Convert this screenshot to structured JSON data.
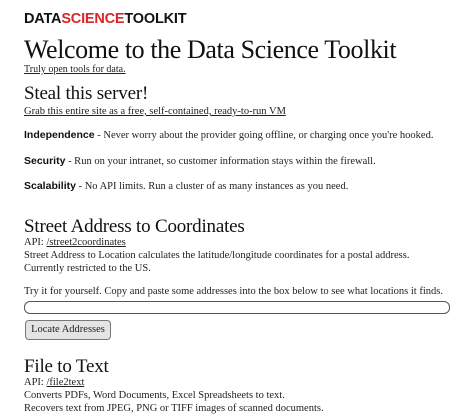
{
  "logo": {
    "part1": "DATA",
    "part2": "SCIENCE",
    "part3": "TOOLKIT"
  },
  "header": {
    "title": "Welcome to the Data Science Toolkit",
    "tagline": "Truly open tools for data."
  },
  "server": {
    "heading": "Steal this server!",
    "link": "Grab this entire site as a free, self-contained, ready-to-run VM",
    "features": [
      {
        "label": "Independence",
        "text": " - Never worry about the provider going offline, or charging once you're hooked."
      },
      {
        "label": "Security",
        "text": " - Run on your intranet, so customer information stays within the firewall."
      },
      {
        "label": "Scalability",
        "text": " - No API limits. Run a cluster of  as many instances as you need."
      }
    ]
  },
  "street": {
    "heading": "Street Address to Coordinates",
    "api_prefix": "API: ",
    "api_link": "/street2coordinates",
    "desc1": "Street Address to Location calculates the latitude/longitude coordinates for a postal address.",
    "desc2": "Currently restricted to the US.",
    "try_text": "Try it for yourself. Copy and paste some addresses into the box below to see what locations it finds.",
    "input_value": "",
    "button_label": "Locate Addresses"
  },
  "file": {
    "heading": "File to Text",
    "api_prefix": "API: ",
    "api_link": "/file2text",
    "desc1": "Converts PDFs, Word Documents, Excel Spreadsheets to text.",
    "desc2": "Recovers text from JPEG, PNG or TIFF images of scanned documents."
  }
}
